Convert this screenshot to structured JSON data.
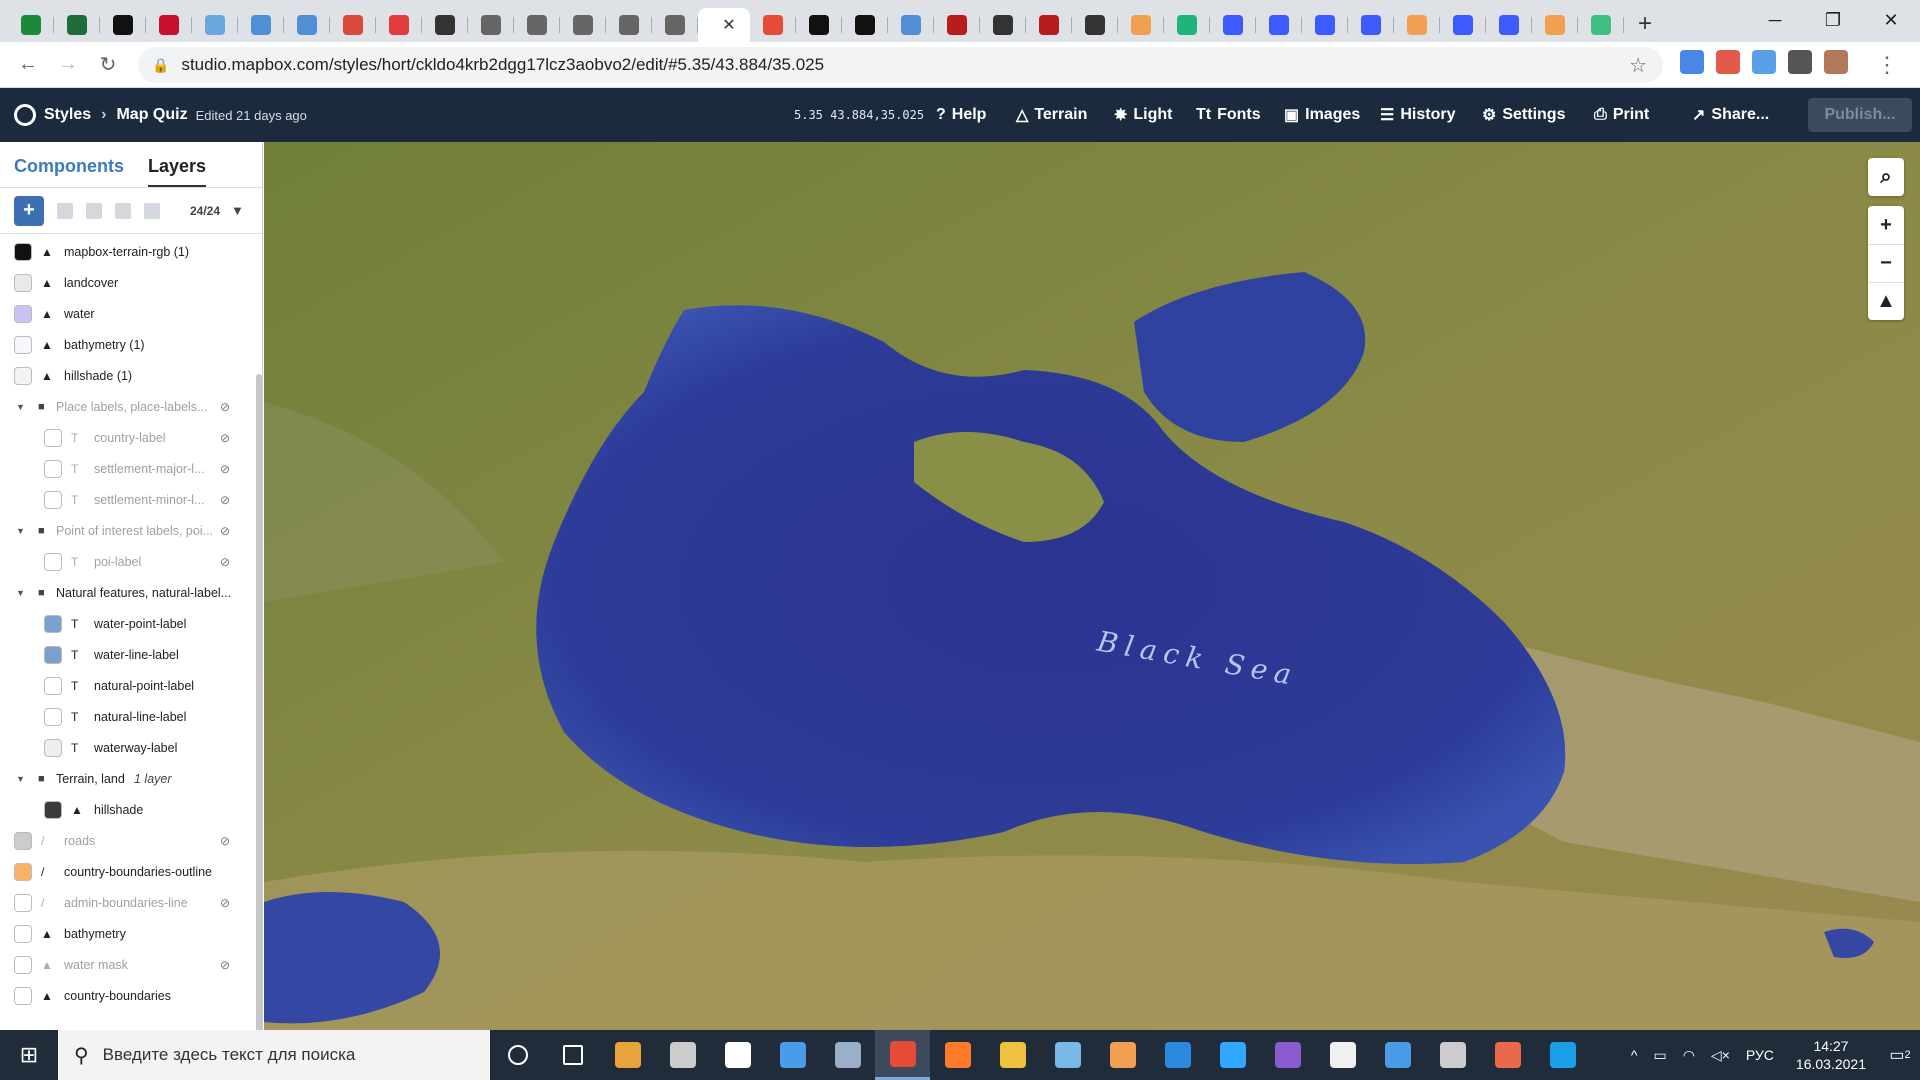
{
  "browser": {
    "url": "studio.mapbox.com/styles/hort/ckldo4krb2dgg17lcz3aobvo2/edit/#5.35/43.884/35.025",
    "new_tab": "+",
    "active_tab_close": "✕",
    "tab_favicon_colors": [
      "#1a8a3a",
      "#1f6b3a",
      "#111111",
      "#c8102e",
      "#6aa6e0",
      "#4f8fd6",
      "#4f8fd6",
      "#d94a3a",
      "#e23b3b",
      "#333333",
      "#666666",
      "#666666",
      "#666666",
      "#666666",
      "#666666",
      "#ffffff",
      "#e84a3a",
      "#111111",
      "#111111",
      "#4f8fd6",
      "#b81d1d",
      "#333333",
      "#b81d1d",
      "#333333",
      "#f0a050",
      "#1fb57a",
      "#3d5afe",
      "#3d5afe",
      "#3d5afe",
      "#3d5afe",
      "#f0a050",
      "#3d5afe",
      "#3d5afe",
      "#f0a050",
      "#3fbf7f"
    ],
    "extension_colors": [
      "#4a86e8",
      "#e45a4a",
      "#5aa0e8",
      "#555555",
      "#b07a5a"
    ]
  },
  "header": {
    "brand": "Styles",
    "style_name": "Map Quiz",
    "edited": "Edited 21 days ago",
    "coords": "5.35 43.884,35.025",
    "help": "Help",
    "terrain": "Terrain",
    "light": "Light",
    "fonts": "Fonts",
    "images": "Images",
    "history": "History",
    "settings": "Settings",
    "print": "Print",
    "share": "Share...",
    "publish": "Publish..."
  },
  "sidebar": {
    "tabs": [
      "Components",
      "Layers"
    ],
    "count": "24/24",
    "layers": [
      {
        "name": "mapbox-terrain-rgb (1)",
        "swatch": "#111111",
        "icon": "▲",
        "indent": 0,
        "faded": false,
        "hidden": false
      },
      {
        "name": "landcover",
        "swatch": "#e9e9e9",
        "icon": "▲",
        "indent": 0,
        "faded": false,
        "hidden": false
      },
      {
        "name": "water",
        "swatch": "#c9c2f5",
        "icon": "▲",
        "indent": 0,
        "faded": false,
        "hidden": false
      },
      {
        "name": "bathymetry (1)",
        "swatch": "#f7f7fb",
        "icon": "▲",
        "indent": 0,
        "faded": false,
        "hidden": false
      },
      {
        "name": "hillshade (1)",
        "swatch": "#f3f3f3",
        "icon": "▲",
        "indent": 0,
        "faded": false,
        "hidden": false
      },
      {
        "name": "Place labels, place-labels...",
        "group": true,
        "faded": true,
        "hidden": true
      },
      {
        "name": "country-label",
        "swatch": "#ffffff",
        "icon": "T",
        "indent": 1,
        "faded": true,
        "hidden": true
      },
      {
        "name": "settlement-major-l...",
        "swatch": "#ffffff",
        "icon": "T",
        "indent": 1,
        "faded": true,
        "hidden": true
      },
      {
        "name": "settlement-minor-l...",
        "swatch": "#ffffff",
        "icon": "T",
        "indent": 1,
        "faded": true,
        "hidden": true
      },
      {
        "name": "Point of interest labels, poi...",
        "group": true,
        "faded": true,
        "hidden": true
      },
      {
        "name": "poi-label",
        "swatch": "#ffffff",
        "icon": "T",
        "indent": 1,
        "faded": true,
        "hidden": true
      },
      {
        "name": "Natural features, natural-label...",
        "group": true,
        "faded": false,
        "hidden": false
      },
      {
        "name": "water-point-label",
        "swatch": "#7aa0cf",
        "icon": "T",
        "indent": 1,
        "faded": false,
        "hidden": false
      },
      {
        "name": "water-line-label",
        "swatch": "#7aa0cf",
        "icon": "T",
        "indent": 1,
        "faded": false,
        "hidden": false
      },
      {
        "name": "natural-point-label",
        "swatch": "#ffffff",
        "icon": "T",
        "indent": 1,
        "faded": false,
        "hidden": false
      },
      {
        "name": "natural-line-label",
        "swatch": "#ffffff",
        "icon": "T",
        "indent": 1,
        "faded": false,
        "hidden": false
      },
      {
        "name": "waterway-label",
        "swatch": "#eeeeee",
        "icon": "T",
        "indent": 1,
        "faded": false,
        "hidden": false
      },
      {
        "name": "Terrain, land",
        "group": true,
        "note": "1 layer",
        "faded": false,
        "hidden": false
      },
      {
        "name": "hillshade",
        "swatch": "#3a3a3a",
        "icon": "▲",
        "indent": 1,
        "faded": false,
        "hidden": false
      },
      {
        "name": "roads",
        "swatch": "#cccccc",
        "icon": "/",
        "indent": 0,
        "faded": true,
        "hidden": true
      },
      {
        "name": "country-boundaries-outline",
        "swatch": "#f7b267",
        "icon": "/",
        "indent": 0,
        "faded": false,
        "hidden": false
      },
      {
        "name": "admin-boundaries-line",
        "swatch": "#ffffff",
        "icon": "/",
        "indent": 0,
        "faded": true,
        "hidden": true
      },
      {
        "name": "bathymetry",
        "swatch": "#ffffff",
        "icon": "▲",
        "indent": 0,
        "faded": false,
        "hidden": false
      },
      {
        "name": "water mask",
        "swatch": "#ffffff",
        "icon": "▲",
        "indent": 0,
        "faded": true,
        "hidden": true
      },
      {
        "name": "country-boundaries",
        "swatch": "#ffffff",
        "icon": "▲",
        "indent": 0,
        "faded": false,
        "hidden": false
      }
    ]
  },
  "map": {
    "sea_label": "Black Sea",
    "sea_color": "#2a3893",
    "land_color": "#7c8a45"
  },
  "taskbar": {
    "search_placeholder": "Введите здесь текст для поиска",
    "apps": [
      "cortana",
      "task-view",
      "store",
      "settings",
      "security",
      "mail",
      "photos",
      "chrome",
      "firefox",
      "explorer",
      "notepad",
      "sublime",
      "vscode",
      "photoshop",
      "visual-studio",
      "clock",
      "calendar",
      "settings-2",
      "game",
      "skype"
    ],
    "app_colors": [
      "#ffffff",
      "#ffffff",
      "#e8a33d",
      "#cccccc",
      "#ffffff",
      "#4a9be8",
      "#9ab0c8",
      "#e84a3a",
      "#ff7b2a",
      "#f0c040",
      "#7ab8e8",
      "#f0a050",
      "#2a8ae0",
      "#31a8ff",
      "#8a5ad0",
      "#f0f0f0",
      "#4a9be8",
      "#cccccc",
      "#e86a4a",
      "#1aa0e8"
    ],
    "lang": "РУС",
    "time": "14:27",
    "date": "16.03.2021",
    "notif_count": "2"
  }
}
